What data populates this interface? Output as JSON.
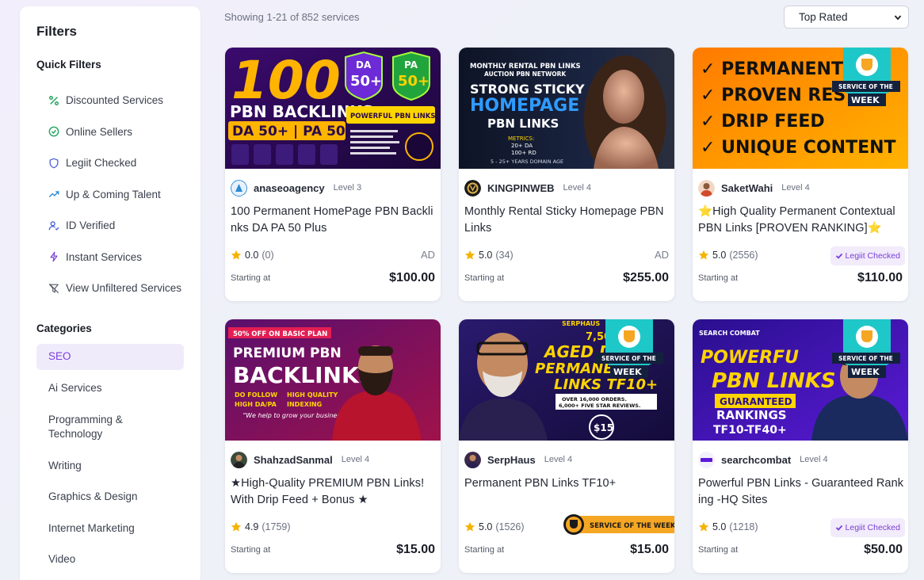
{
  "sidebar": {
    "title": "Filters",
    "quick_filters_title": "Quick Filters",
    "quick_filters": [
      {
        "label": "Discounted Services",
        "icon": "percent-icon"
      },
      {
        "label": "Online Sellers",
        "icon": "check-circle-icon"
      },
      {
        "label": "Legiit Checked",
        "icon": "shield-icon"
      },
      {
        "label": "Up & Coming Talent",
        "icon": "trending-up-icon"
      },
      {
        "label": "ID Verified",
        "icon": "user-check-icon"
      },
      {
        "label": "Instant Services",
        "icon": "lightning-icon"
      },
      {
        "label": "View Unfiltered Services",
        "icon": "filter-off-icon"
      }
    ],
    "categories_title": "Categories",
    "categories": [
      {
        "label": "SEO",
        "active": true
      },
      {
        "label": "Ai Services"
      },
      {
        "label": "Programming & Technology"
      },
      {
        "label": "Writing"
      },
      {
        "label": "Graphics & Design"
      },
      {
        "label": "Internet Marketing"
      },
      {
        "label": "Video"
      }
    ]
  },
  "topbar": {
    "count_text": "Showing 1-21 of 852 services",
    "sort_selected": "Top Rated"
  },
  "colors": {
    "accent": "#7a3fd6",
    "legiit_bg": "#f1ebfb",
    "star": "#f5b301",
    "sotw": "#f5a623"
  },
  "cards": [
    {
      "seller": "anaseoagency",
      "level": "Level 3",
      "title": "100 Permanent HomePage PBN Backlinks DA PA 50 Plus",
      "rating": "0.0",
      "reviews": "(0)",
      "tag": "AD",
      "starting": "Starting at",
      "price": "$100.00",
      "thumb": {
        "line1": "100",
        "line2": "PBN BACKLINKS",
        "line3": "DA 50+ | PA 50+",
        "b1": "DA",
        "b1v": "50+",
        "b2": "PA",
        "b2v": "50+",
        "sub": "POWERFUL PBN LINKS"
      }
    },
    {
      "seller": "KINGPINWEB",
      "level": "Level 4",
      "title": "Monthly Rental Sticky Homepage PBN Links",
      "rating": "5.0",
      "reviews": "(34)",
      "tag": "AD",
      "starting": "Starting at",
      "price": "$255.00",
      "thumb": {
        "line1": "MONTHLY RENTAL PBN LINKS",
        "line2": "AUCTION PBN NETWORK",
        "line3": "STRONG STICKY",
        "line4": "HOMEPAGE",
        "line5": "PBN LINKS",
        "m1": "METRICS:",
        "m2": "20+ DA",
        "m3": "100+ RD",
        "m4": "5 - 25+ YEARS DOMAIN AGE"
      }
    },
    {
      "seller": "SaketWahi",
      "level": "Level 4",
      "title": "⭐High Quality Permanent Contextual PBN Links [PROVEN RANKING]⭐",
      "rating": "5.0",
      "reviews": "(2556)",
      "tag": "Legiit Checked",
      "starting": "Starting at",
      "price": "$110.00",
      "thumb": {
        "l1": "✓ PERMANENT",
        "l2": "✓ PROVEN RES",
        "l3": "✓ DRIP FEED",
        "l4": "✓ UNIQUE CONTENT",
        "s1": "SERVICE OF THE",
        "s2": "WEEK"
      }
    },
    {
      "seller": "ShahzadSanmal",
      "level": "Level 4",
      "title": "★High-Quality PREMIUM PBN Links! With Drip Feed + Bonus ★",
      "rating": "4.9",
      "reviews": "(1759)",
      "tag": "",
      "starting": "Starting at",
      "price": "$15.00",
      "thumb": {
        "top": "50% OFF ON BASIC PLAN",
        "l1": "PREMIUM PBN",
        "l2": "BACKLINKS",
        "f1": "DO FOLLOW",
        "f2": "HIGH QUALITY",
        "f3": "HIGH DA/PA",
        "f4": "INDEXING",
        "q": "“We help to grow your business”"
      }
    },
    {
      "seller": "SerpHaus",
      "level": "Level 4",
      "title": "Permanent PBN Links TF10+",
      "rating": "5.0",
      "reviews": "(1526)",
      "tag": "SERVICE OF THE WEEK",
      "starting": "Starting at",
      "price": "$15.00",
      "thumb": {
        "brand": "SERPHAUS",
        "num": "7,50",
        "l1": "AGED D",
        "l2": "PERMANEN",
        "l3": "LINKS TF10+",
        "l4": "OVER 16,000 ORDERS.",
        "l5": "6,000+ FIVE STAR REVIEWS.",
        "p": "$15",
        "s1": "SERVICE OF THE",
        "s2": "WEEK"
      }
    },
    {
      "seller": "searchcombat",
      "level": "Level 4",
      "title": "Powerful PBN Links - Guaranteed Ranking -HQ Sites",
      "rating": "5.0",
      "reviews": "(1218)",
      "tag": "Legiit Checked",
      "starting": "Starting at",
      "price": "$50.00",
      "thumb": {
        "brand": "SEARCH COMBAT",
        "l1": "POWERFU",
        "l2": "PBN LINKS",
        "l3": "GUARANTEED",
        "l4": "RANKINGS",
        "l5": "TF10-TF40+",
        "s1": "SERVICE OF THE",
        "s2": "WEEK"
      }
    }
  ]
}
